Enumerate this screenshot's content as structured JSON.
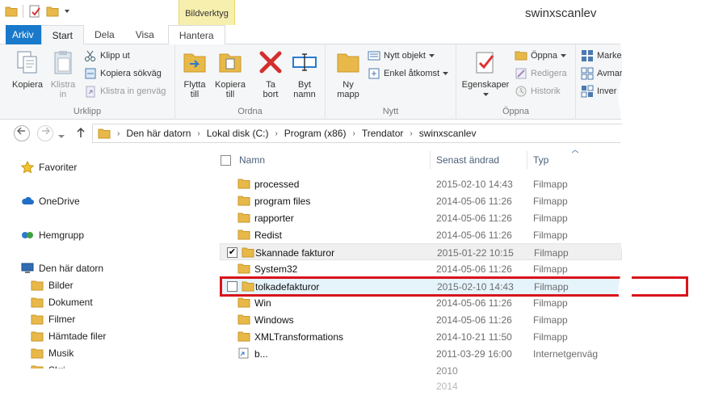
{
  "window": {
    "title": "swinxscanlev",
    "contextual_tab": "Bildverktyg"
  },
  "ribbon_tabs": [
    {
      "label": "Arkiv"
    },
    {
      "label": "Start"
    },
    {
      "label": "Dela"
    },
    {
      "label": "Visa"
    },
    {
      "label": "Hantera"
    }
  ],
  "ribbon": {
    "urklipp": {
      "label": "Urklipp",
      "copy": "Kopiera",
      "paste_l1": "Klistra",
      "paste_l2": "in",
      "cut": "Klipp ut",
      "copy_path": "Kopiera sökväg",
      "paste_shortcut": "Klistra in genväg"
    },
    "ordna": {
      "label": "Ordna",
      "move_l1": "Flytta",
      "move_l2": "till",
      "copyto_l1": "Kopiera",
      "copyto_l2": "till",
      "delete_l1": "Ta",
      "delete_l2": "bort",
      "rename_l1": "Byt",
      "rename_l2": "namn"
    },
    "nytt": {
      "label": "Nytt",
      "new_folder_l1": "Ny",
      "new_folder_l2": "mapp",
      "new_item": "Nytt objekt",
      "easy_access": "Enkel åtkomst"
    },
    "oppna": {
      "label": "Öppna",
      "properties": "Egenskaper",
      "open": "Öppna",
      "edit": "Redigera",
      "history": "Historik"
    },
    "markera": {
      "select_all": "Markera",
      "select_none": "Avmar",
      "invert": "Inver"
    }
  },
  "address": {
    "crumbs": [
      "Den här datorn",
      "Lokal disk (C:)",
      "Program (x86)",
      "Trendator",
      "swinxscanlev"
    ]
  },
  "nav": {
    "favorites": "Favoriter",
    "onedrive": "OneDrive",
    "homegroup": "Hemgrupp",
    "thispc": "Den här datorn",
    "pictures": "Bilder",
    "documents": "Dokument",
    "movies": "Filmer",
    "downloads": "Hämtade filer",
    "music": "Musik",
    "desktop": "Skri"
  },
  "columns": {
    "name": "Namn",
    "modified": "Senast ändrad",
    "type": "Typ"
  },
  "files": [
    {
      "name": "processed",
      "date": "2015-02-10 14:43",
      "type": "Filmapp"
    },
    {
      "name": "program files",
      "date": "2014-05-06 11:26",
      "type": "Filmapp"
    },
    {
      "name": "rapporter",
      "date": "2014-05-06 11:26",
      "type": "Filmapp"
    },
    {
      "name": "Redist",
      "date": "2014-05-06 11:26",
      "type": "Filmapp"
    },
    {
      "name": "Skannade fakturor",
      "date": "2015-01-22 10:15",
      "type": "Filmapp",
      "checked": true
    },
    {
      "name": "System32",
      "date": "2014-05-06 11:26",
      "type": "Filmapp"
    },
    {
      "name": "tolkadefakturor",
      "date": "2015-02-10 14:43",
      "type": "Filmapp",
      "hover": true
    },
    {
      "name": "Win",
      "date": "2014-05-06 11:26",
      "type": "Filmapp"
    },
    {
      "name": "Windows",
      "date": "2014-05-06 11:26",
      "type": "Filmapp"
    },
    {
      "name": "XMLTransformations",
      "date": "2014-10-21 11:50",
      "type": "Filmapp"
    },
    {
      "name": "b...",
      "date": "2011-03-29 16:00",
      "type": "Internetgenväg"
    }
  ],
  "faded": {
    "date1": "2010",
    "date2": "2014"
  },
  "colors": {
    "file_tab": "#1979ca",
    "context_tab": "#f7efae",
    "highlight": "#d9141b",
    "folder": "#e8b949"
  }
}
